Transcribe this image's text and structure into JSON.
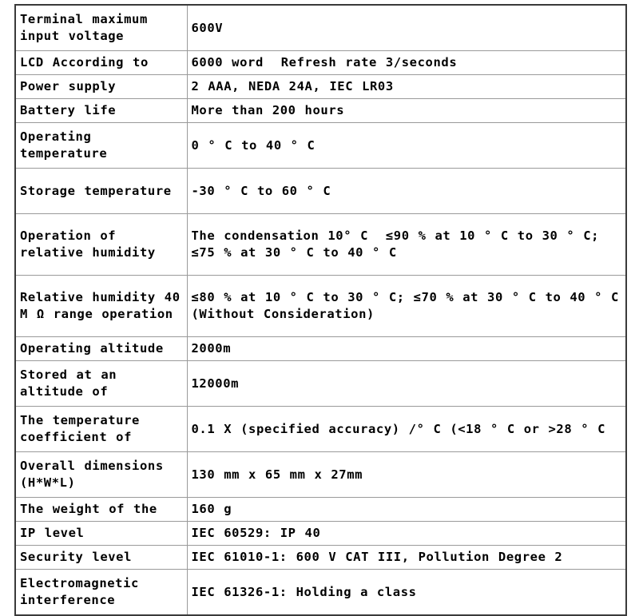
{
  "document": {
    "type": "specifications-table",
    "columns": [
      "parameter",
      "specification"
    ],
    "rows": [
      {
        "label": "Terminal maximum input voltage",
        "value": "600V",
        "size": "tall"
      },
      {
        "label": "LCD According to",
        "value": "6000 word  Refresh rate 3/seconds",
        "size": "short"
      },
      {
        "label": "Power supply",
        "value": "2 AAA, NEDA 24A, IEC LR03",
        "size": "short"
      },
      {
        "label": "Battery life",
        "value": "More than 200 hours",
        "size": "short"
      },
      {
        "label": "Operating temperature",
        "value": "0 ° C to 40 ° C",
        "size": "tall"
      },
      {
        "label": "Storage temperature",
        "value": "-30 ° C to 60 ° C",
        "size": "tall"
      },
      {
        "label": "Operation of relative humidity",
        "value": "The condensation 10° C  ≤90 % at 10 ° C to 30 ° C; ≤75 % at 30 ° C to 40 ° C",
        "size": "xtall"
      },
      {
        "label": "Relative humidity 40 M Ω range operation",
        "value": "≤80 % at 10 ° C to 30 ° C; ≤70 % at 30 ° C to 40 ° C (Without Consideration)",
        "size": "xtall"
      },
      {
        "label": "Operating altitude",
        "value": "2000m",
        "size": "short"
      },
      {
        "label": "Stored at an altitude of",
        "value": "12000m",
        "size": "tall"
      },
      {
        "label": "The temperature coefficient of",
        "value": "0.1 X (specified accuracy) /° C (<18 ° C or >28 ° C",
        "size": "tall"
      },
      {
        "label": "Overall dimensions (H*W*L)",
        "value": "130 mm x 65 mm x 27mm",
        "size": "tall"
      },
      {
        "label": "The weight of the",
        "value": "160 g",
        "size": "short"
      },
      {
        "label": "IP level",
        "value": "IEC 60529: IP 40",
        "size": "short"
      },
      {
        "label": "Security level",
        "value": "IEC 61010-1: 600 V CAT III, Pollution Degree 2",
        "size": "short"
      },
      {
        "label": "Electromagnetic interference",
        "value": "IEC 61326-1: Holding a class",
        "size": "tall"
      }
    ]
  },
  "style": {
    "page_background": "#ffffff",
    "text_color": "#000000",
    "outer_border_color": "#3a3a3a",
    "inner_border_color": "#9a9a9a"
  }
}
